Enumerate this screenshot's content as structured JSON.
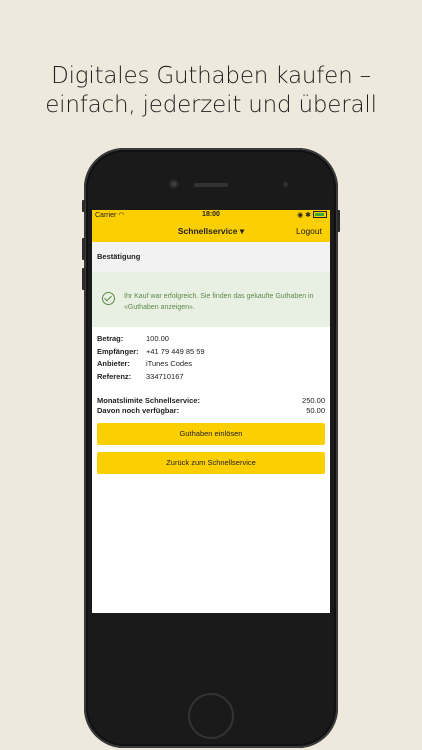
{
  "headline": {
    "line1": "Digitales Guthaben kaufen –",
    "line2": "einfach, jederzeit und überall"
  },
  "statusbar": {
    "carrier": "Carrier",
    "time": "18:00"
  },
  "navbar": {
    "title": "Schnellservice",
    "logout": "Logout"
  },
  "section": {
    "title": "Bestätigung"
  },
  "notice": {
    "text": "Ihr Kauf war erfolgreich. Sie finden das gekaufte Guthaben in «Guthaben anzeigen»."
  },
  "details": [
    {
      "label": "Betrag:",
      "value": "100.00"
    },
    {
      "label": "Empfänger:",
      "value": "+41 79 449 85 59"
    },
    {
      "label": "Anbieter:",
      "value": "iTunes Codes"
    },
    {
      "label": "Referenz:",
      "value": "334710167"
    }
  ],
  "totals": [
    {
      "label": "Monatslimite Schnellservice:",
      "value": "250.00"
    },
    {
      "label": "Davon noch verfügbar:",
      "value": "50.00"
    }
  ],
  "buttons": {
    "redeem": "Guthaben einlösen",
    "back": "Zurück zum Schnellservice"
  },
  "colors": {
    "accent": "#fbcf00",
    "success": "#5e8a4a",
    "background": "#efe8dc"
  }
}
